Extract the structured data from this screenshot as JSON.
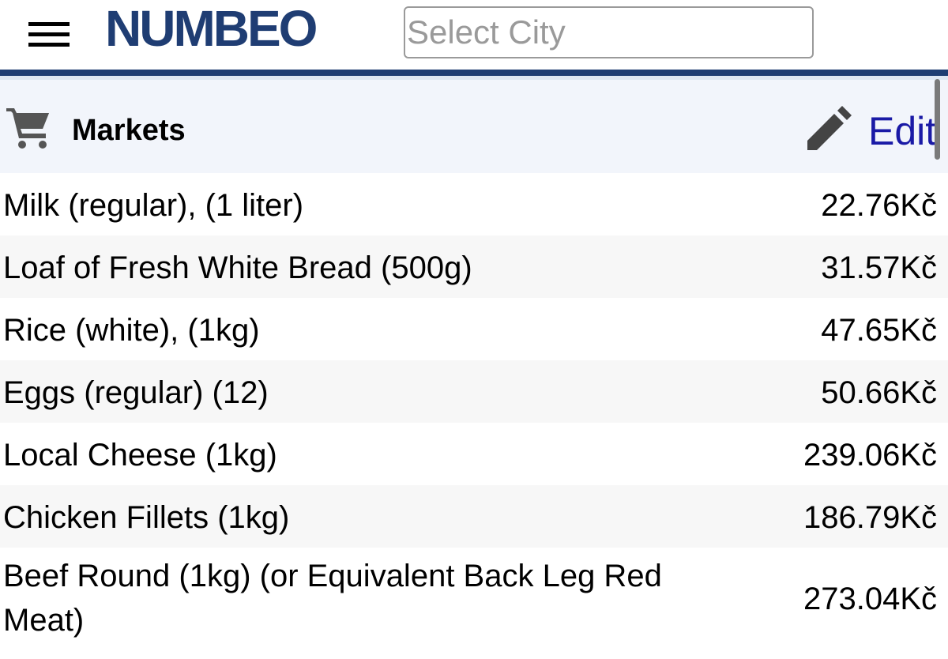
{
  "header": {
    "logo": "NUMBEO",
    "search_placeholder": "Select City"
  },
  "section": {
    "title": "Markets",
    "edit_label": "Edit"
  },
  "icons": {
    "menu": "hamburger-menu-icon",
    "cart": "shopping-cart-icon",
    "edit": "pencil-icon"
  },
  "colors": {
    "brand": "#1f3d73",
    "link": "#1a1aa6",
    "section_background": "#f2f5fb"
  },
  "items": [
    {
      "name": "Milk (regular), (1 liter)",
      "price": "22.76Kč"
    },
    {
      "name": "Loaf of Fresh White Bread (500g)",
      "price": "31.57Kč"
    },
    {
      "name": "Rice (white), (1kg)",
      "price": "47.65Kč"
    },
    {
      "name": "Eggs (regular) (12)",
      "price": "50.66Kč"
    },
    {
      "name": "Local Cheese (1kg)",
      "price": "239.06Kč"
    },
    {
      "name": "Chicken Fillets (1kg)",
      "price": "186.79Kč"
    },
    {
      "name": "Beef Round (1kg) (or Equivalent Back Leg Red Meat)",
      "price": "273.04Kč"
    }
  ]
}
